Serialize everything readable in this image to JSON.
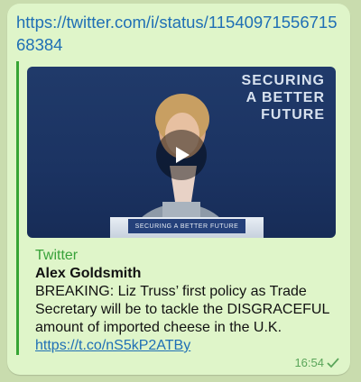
{
  "message": {
    "url": "https://twitter.com/i/status/1154097155671568384",
    "link_preview": {
      "site_name": "Twitter",
      "title": "Alex Goldsmith",
      "description": "BREAKING: Liz Truss’ first policy as Trade Secretary will be to tackle the DISGRACEFUL amount of imported cheese in the U.K. ",
      "description_link": "https://t.co/nS5kP2ATBy",
      "thumbnail": {
        "slogan_line1": "SECURING",
        "slogan_line2": "A BETTER",
        "slogan_line3": "FUTURE",
        "podium_text": "SECURING A BETTER FUTURE"
      }
    },
    "time": "16:54",
    "status_icon": "check-icon"
  },
  "colors": {
    "chat_background": "#c9dcae",
    "bubble": "#dff5c9",
    "link": "#1f6fb5",
    "accent": "#37a535"
  }
}
